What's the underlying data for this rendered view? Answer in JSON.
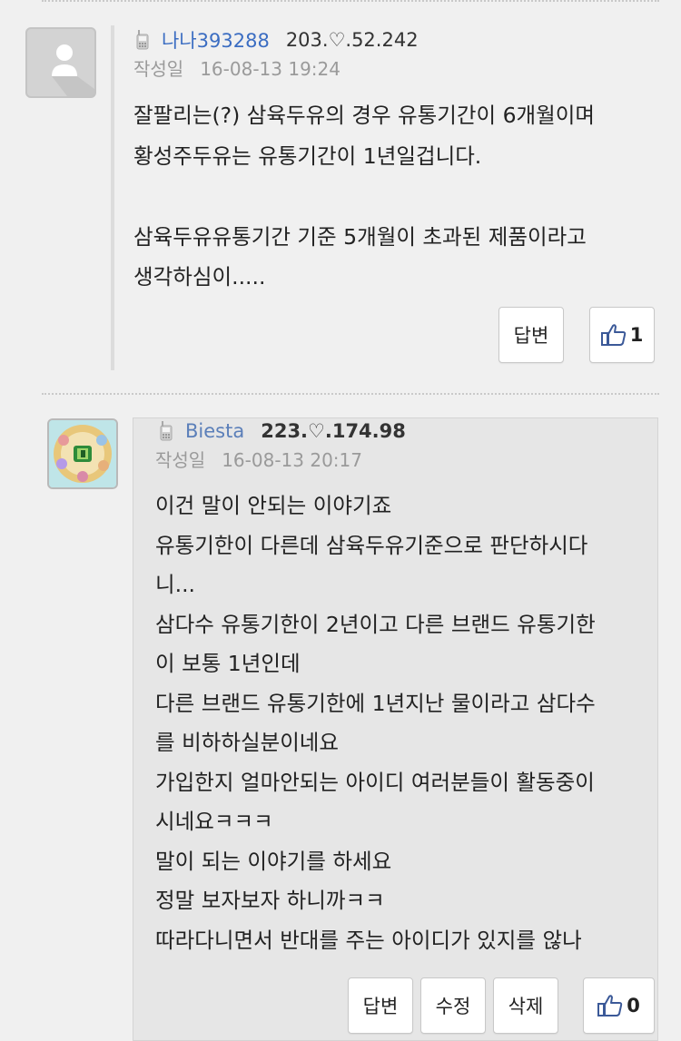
{
  "comments": [
    {
      "nickname": "나나393288",
      "ip": "203.♡.52.242",
      "date_label": "작성일",
      "date": "16-08-13 19:24",
      "lines": [
        "잘팔리는(?) 삼육두유의 경우 유통기간이 6개월이며",
        "황성주두유는 유통기간이 1년일겁니다.",
        "",
        "삼육두유유통기간 기준 5개월이 초과된 제품이라고",
        "생각하심이....."
      ],
      "buttons": {
        "reply": "답변",
        "like_count": "1"
      }
    },
    {
      "nickname": "Biesta",
      "ip": "223.♡.174.98",
      "date_label": "작성일",
      "date": "16-08-13 20:17",
      "lines": [
        "이건 말이 안되는 이야기죠",
        "유통기한이 다른데 삼육두유기준으로 판단하시다",
        "니...",
        "삼다수 유통기한이 2년이고 다른 브랜드 유통기한",
        "이 보통 1년인데",
        "다른 브랜드 유통기한에 1년지난 물이라고 삼다수",
        "를 비하하실분이네요",
        "가입한지 얼마안되는 아이디 여러분들이 활동중이",
        "시네요ㅋㅋㅋ",
        "말이 되는 이야기를 하세요",
        "정말 보자보자 하니까ㅋㅋ",
        "따라다니면서 반대를 주는 아이디가 있지를 않나"
      ],
      "buttons": {
        "reply": "답변",
        "edit": "수정",
        "delete": "삭제",
        "like_count": "0"
      }
    }
  ],
  "icons": {
    "device": "mobile-phone-icon",
    "like": "thumbs-up-icon",
    "avatar_default": "user-silhouette-icon"
  },
  "colors": {
    "nickname": "#3b6dc2",
    "like_icon": "#3b5998",
    "highlight_bg": "#e6e6e6"
  }
}
